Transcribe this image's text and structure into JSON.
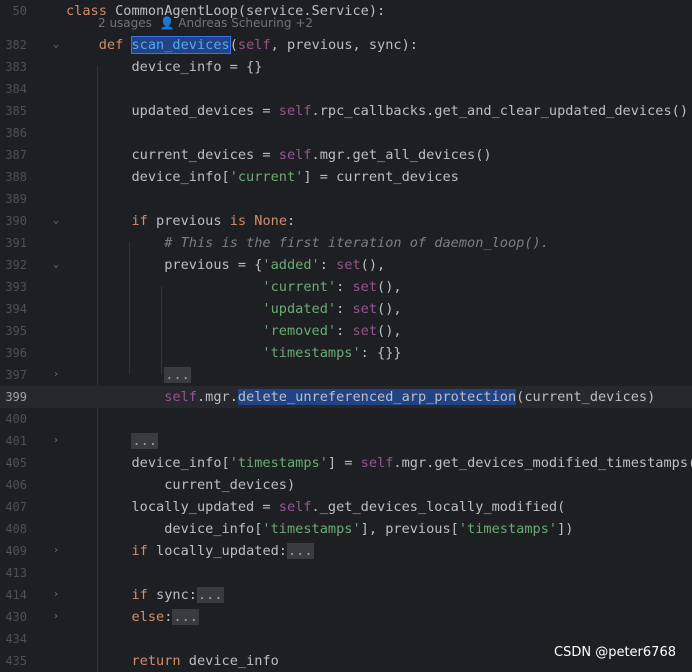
{
  "editor": {
    "lines": [
      {
        "num": "50",
        "fold": "",
        "parts": [
          [
            "kw",
            "class "
          ],
          [
            "cls",
            "CommonAgentLoop(service.Service):"
          ]
        ]
      },
      {
        "num": "",
        "fold": "",
        "usage": "2 usages  👤 Andreas Scheuring +2"
      },
      {
        "num": "382",
        "fold": "v",
        "parts": [
          [
            "",
            "    "
          ],
          [
            "kw",
            "def "
          ],
          [
            "sel-def",
            "scan_devices"
          ],
          [
            "",
            "("
          ],
          [
            "self",
            "self"
          ],
          [
            "",
            ", previous, sync):"
          ]
        ]
      },
      {
        "num": "383",
        "fold": "",
        "parts": [
          [
            "",
            "        device_info = {}"
          ]
        ]
      },
      {
        "num": "384",
        "fold": "",
        "parts": [
          [
            "",
            ""
          ]
        ]
      },
      {
        "num": "385",
        "fold": "",
        "parts": [
          [
            "",
            "        updated_devices = "
          ],
          [
            "self",
            "self"
          ],
          [
            "",
            ".rpc_callbacks.get_and_clear_updated_devices()"
          ]
        ]
      },
      {
        "num": "386",
        "fold": "",
        "parts": [
          [
            "",
            ""
          ]
        ]
      },
      {
        "num": "387",
        "fold": "",
        "parts": [
          [
            "",
            "        current_devices = "
          ],
          [
            "self",
            "self"
          ],
          [
            "",
            ".mgr.get_all_devices()"
          ]
        ]
      },
      {
        "num": "388",
        "fold": "",
        "parts": [
          [
            "",
            "        device_info["
          ],
          [
            "str",
            "'current'"
          ],
          [
            "",
            "] = current_devices"
          ]
        ]
      },
      {
        "num": "389",
        "fold": "",
        "parts": [
          [
            "",
            ""
          ]
        ]
      },
      {
        "num": "390",
        "fold": "v",
        "parts": [
          [
            "",
            "        "
          ],
          [
            "kw",
            "if "
          ],
          [
            "",
            "previous "
          ],
          [
            "kw",
            "is None"
          ],
          [
            "",
            ":"
          ]
        ]
      },
      {
        "num": "391",
        "fold": "",
        "parts": [
          [
            "",
            "            "
          ],
          [
            "cmt",
            "# This is the first iteration of daemon_loop()."
          ]
        ]
      },
      {
        "num": "392",
        "fold": "v",
        "parts": [
          [
            "",
            "            previous = {"
          ],
          [
            "str",
            "'added'"
          ],
          [
            "",
            ": "
          ],
          [
            "self",
            "set"
          ],
          [
            "",
            "(),"
          ]
        ]
      },
      {
        "num": "393",
        "fold": "",
        "parts": [
          [
            "",
            "                        "
          ],
          [
            "str",
            "'current'"
          ],
          [
            "",
            ": "
          ],
          [
            "self",
            "set"
          ],
          [
            "",
            "(),"
          ]
        ]
      },
      {
        "num": "394",
        "fold": "",
        "parts": [
          [
            "",
            "                        "
          ],
          [
            "str",
            "'updated'"
          ],
          [
            "",
            ": "
          ],
          [
            "self",
            "set"
          ],
          [
            "",
            "(),"
          ]
        ]
      },
      {
        "num": "395",
        "fold": "",
        "parts": [
          [
            "",
            "                        "
          ],
          [
            "str",
            "'removed'"
          ],
          [
            "",
            ": "
          ],
          [
            "self",
            "set"
          ],
          [
            "",
            "(),"
          ]
        ]
      },
      {
        "num": "396",
        "fold": "",
        "parts": [
          [
            "",
            "                        "
          ],
          [
            "str",
            "'timestamps'"
          ],
          [
            "",
            ": {}}"
          ]
        ]
      },
      {
        "num": "397",
        "fold": ">",
        "parts": [
          [
            "",
            "            "
          ],
          [
            "folded",
            "..."
          ]
        ]
      },
      {
        "num": "399",
        "fold": "",
        "current": true,
        "parts": [
          [
            "",
            "            "
          ],
          [
            "self",
            "self"
          ],
          [
            "",
            ".mgr."
          ],
          [
            "sel-call",
            "delete_unreferenced_arp_protection"
          ],
          [
            "",
            "(current_devices)"
          ]
        ]
      },
      {
        "num": "400",
        "fold": "",
        "parts": [
          [
            "",
            ""
          ]
        ]
      },
      {
        "num": "401",
        "fold": ">",
        "parts": [
          [
            "",
            "        "
          ],
          [
            "folded",
            "..."
          ]
        ]
      },
      {
        "num": "405",
        "fold": "",
        "parts": [
          [
            "",
            "        device_info["
          ],
          [
            "str",
            "'timestamps'"
          ],
          [
            "",
            "] = "
          ],
          [
            "self",
            "self"
          ],
          [
            "",
            ".mgr.get_devices_modified_timestamps("
          ]
        ]
      },
      {
        "num": "406",
        "fold": "",
        "parts": [
          [
            "",
            "            current_devices)"
          ]
        ]
      },
      {
        "num": "407",
        "fold": "",
        "parts": [
          [
            "",
            "        locally_updated = "
          ],
          [
            "self",
            "self"
          ],
          [
            "",
            "._get_devices_locally_modified("
          ]
        ]
      },
      {
        "num": "408",
        "fold": "",
        "parts": [
          [
            "",
            "            device_info["
          ],
          [
            "str",
            "'timestamps'"
          ],
          [
            "",
            "], previous["
          ],
          [
            "str",
            "'timestamps'"
          ],
          [
            "",
            "])"
          ]
        ]
      },
      {
        "num": "409",
        "fold": ">",
        "parts": [
          [
            "",
            "        "
          ],
          [
            "kw",
            "if "
          ],
          [
            "",
            "locally_updated:"
          ],
          [
            "folded",
            "..."
          ]
        ]
      },
      {
        "num": "413",
        "fold": "",
        "parts": [
          [
            "",
            ""
          ]
        ]
      },
      {
        "num": "414",
        "fold": ">",
        "parts": [
          [
            "",
            "        "
          ],
          [
            "kw",
            "if "
          ],
          [
            "",
            "sync:"
          ],
          [
            "folded",
            "..."
          ]
        ]
      },
      {
        "num": "430",
        "fold": ">",
        "parts": [
          [
            "",
            "        "
          ],
          [
            "kw",
            "else"
          ],
          [
            "",
            ":"
          ],
          [
            "folded",
            "..."
          ]
        ]
      },
      {
        "num": "434",
        "fold": "",
        "parts": [
          [
            "",
            ""
          ]
        ]
      },
      {
        "num": "435",
        "fold": "",
        "parts": [
          [
            "",
            "        "
          ],
          [
            "kw",
            "return "
          ],
          [
            "",
            "device_info"
          ]
        ]
      }
    ]
  },
  "watermark": "CSDN @peter6768"
}
